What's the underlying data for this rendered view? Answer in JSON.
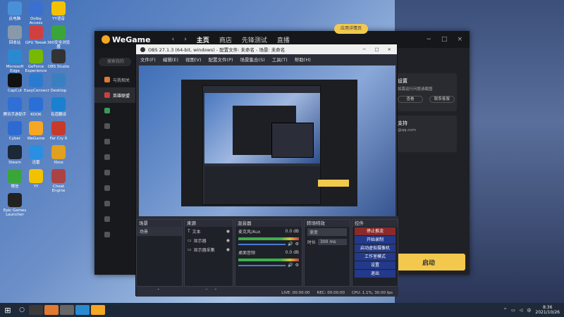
{
  "desktop": {
    "icons": [
      {
        "label": "此电脑",
        "color": "#4a90d9"
      },
      {
        "label": "Dolby Access",
        "color": "#3b6fd0"
      },
      {
        "label": "YY语音",
        "color": "#f2c200"
      },
      {
        "label": "回收站",
        "color": "#8899aa"
      },
      {
        "label": "GPU Tweak",
        "color": "#d04040"
      },
      {
        "label": "360安全浏览器",
        "color": "#3aa63a"
      },
      {
        "label": "Microsoft Edge",
        "color": "#2a8ad0"
      },
      {
        "label": "GeForce Experience",
        "color": "#76b900"
      },
      {
        "label": "OBS Studio",
        "color": "#333333"
      },
      {
        "label": "CapCut",
        "color": "#111111"
      },
      {
        "label": "EasyConnect",
        "color": "#2a7bd0"
      },
      {
        "label": "Desktop",
        "color": "#3a80c0"
      },
      {
        "label": "腾讯手游助手",
        "color": "#2f6fd6"
      },
      {
        "label": "KOOK",
        "color": "#2a6fd6"
      },
      {
        "label": "有道翻译",
        "color": "#1a80d0"
      },
      {
        "label": "Cyber",
        "color": "#2d6ad2"
      },
      {
        "label": "WeGame",
        "color": "#f5a623"
      },
      {
        "label": "Far Cry 6",
        "color": "#c73a2a"
      },
      {
        "label": "Steam",
        "color": "#1b2838"
      },
      {
        "label": "迅雷",
        "color": "#2a8fe0"
      },
      {
        "label": "Xbox",
        "color": "#e0a020"
      },
      {
        "label": "微信",
        "color": "#3aa63a"
      },
      {
        "label": "YY",
        "color": "#f2c200"
      },
      {
        "label": "Cheat Engine",
        "color": "#aa4444"
      },
      {
        "label": "Epic Games Launcher",
        "color": "#222222"
      }
    ]
  },
  "wegame": {
    "logo": "WeGame",
    "nav": [
      "主页",
      "商店",
      "先锋测试",
      "直播"
    ],
    "window_controls": [
      "−",
      "□",
      "×"
    ],
    "search_placeholder": "搜索我的",
    "sidebar": [
      "与我相关",
      "英雄联盟",
      "",
      "",
      "",
      "",
      "",
      "",
      "",
      "",
      ""
    ],
    "apply_button": "应用详情页",
    "card1_title": "设置",
    "card1_sub": "如需运行问题请截图",
    "card1_btn1": "查看",
    "card1_btn2": "联系客服",
    "card2_title": "支持",
    "card2_sub": "@qq.com",
    "launch_button": "启动"
  },
  "obs": {
    "title": "OBS 27.1.3 (64-bit, windows) - 配置文件: 未命名 - 场景: 未命名",
    "menu": [
      "文件(F)",
      "编辑(E)",
      "视图(V)",
      "配置文件(P)",
      "场景集合(S)",
      "工具(T)",
      "帮助(H)"
    ],
    "scenes_header": "场景",
    "scene_item": "场景",
    "sources_header": "来源",
    "sources": [
      "文本",
      "显示器",
      "显示器采集"
    ],
    "mixer_header": "混音器",
    "mixer": [
      {
        "name": "麦克风/Aux",
        "db": "0.0 dB"
      },
      {
        "name": "桌面音频",
        "db": "0.0 dB"
      }
    ],
    "transitions_header": "转场特效",
    "transition_type": "渐变",
    "duration_label": "时长",
    "duration_value": "300 ms",
    "controls_header": "控件",
    "controls": [
      "停止推流",
      "开始录制",
      "启动虚拟摄像机",
      "工作室模式",
      "设置",
      "退出"
    ],
    "status": [
      "LIVE: 00:00:00",
      "REC: 00:00:00",
      "CPU: 1.1%, 30.00 fps"
    ]
  },
  "taskbar": {
    "time": "8:36",
    "date": "2021/10/26"
  }
}
